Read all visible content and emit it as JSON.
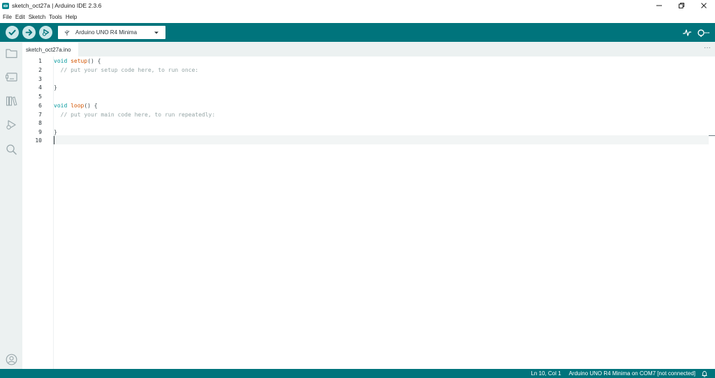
{
  "window": {
    "title": "sketch_oct27a | Arduino IDE 2.3.6",
    "controls": [
      "minimize-icon",
      "restore-icon",
      "close-icon"
    ]
  },
  "menu": [
    "File",
    "Edit",
    "Sketch",
    "Tools",
    "Help"
  ],
  "toolbar": {
    "buttons": [
      "verify-icon",
      "upload-icon",
      "debug-icon"
    ],
    "board": "Arduino UNO R4 Minima",
    "right_icons": [
      "serial-plotter-icon",
      "serial-monitor-icon"
    ]
  },
  "sidebar": {
    "items": [
      "sketchbook-icon",
      "boards-manager-icon",
      "library-manager-icon",
      "debug-panel-icon",
      "search-icon"
    ],
    "bottom": "profile-icon"
  },
  "tab": {
    "label": "sketch_oct27a.ino",
    "more": "···"
  },
  "editor": {
    "lines": [
      {
        "num": "1",
        "text": "void setup() {"
      },
      {
        "num": "2",
        "text": "  // put your setup code here, to run once:"
      },
      {
        "num": "3",
        "text": ""
      },
      {
        "num": "4",
        "text": "}"
      },
      {
        "num": "5",
        "text": ""
      },
      {
        "num": "6",
        "text": "void loop() {"
      },
      {
        "num": "7",
        "text": "  // put your main code here, to run repeatedly:"
      },
      {
        "num": "8",
        "text": ""
      },
      {
        "num": "9",
        "text": "}"
      },
      {
        "num": "10",
        "text": ""
      }
    ]
  },
  "status": {
    "position": "Ln 10, Col 1",
    "connection": "Arduino UNO R4 Minima on COM7 [not connected]"
  },
  "colors": {
    "accent": "#00747c",
    "keyword": "#00979c",
    "function": "#d35400",
    "comment": "#95a5a6"
  }
}
